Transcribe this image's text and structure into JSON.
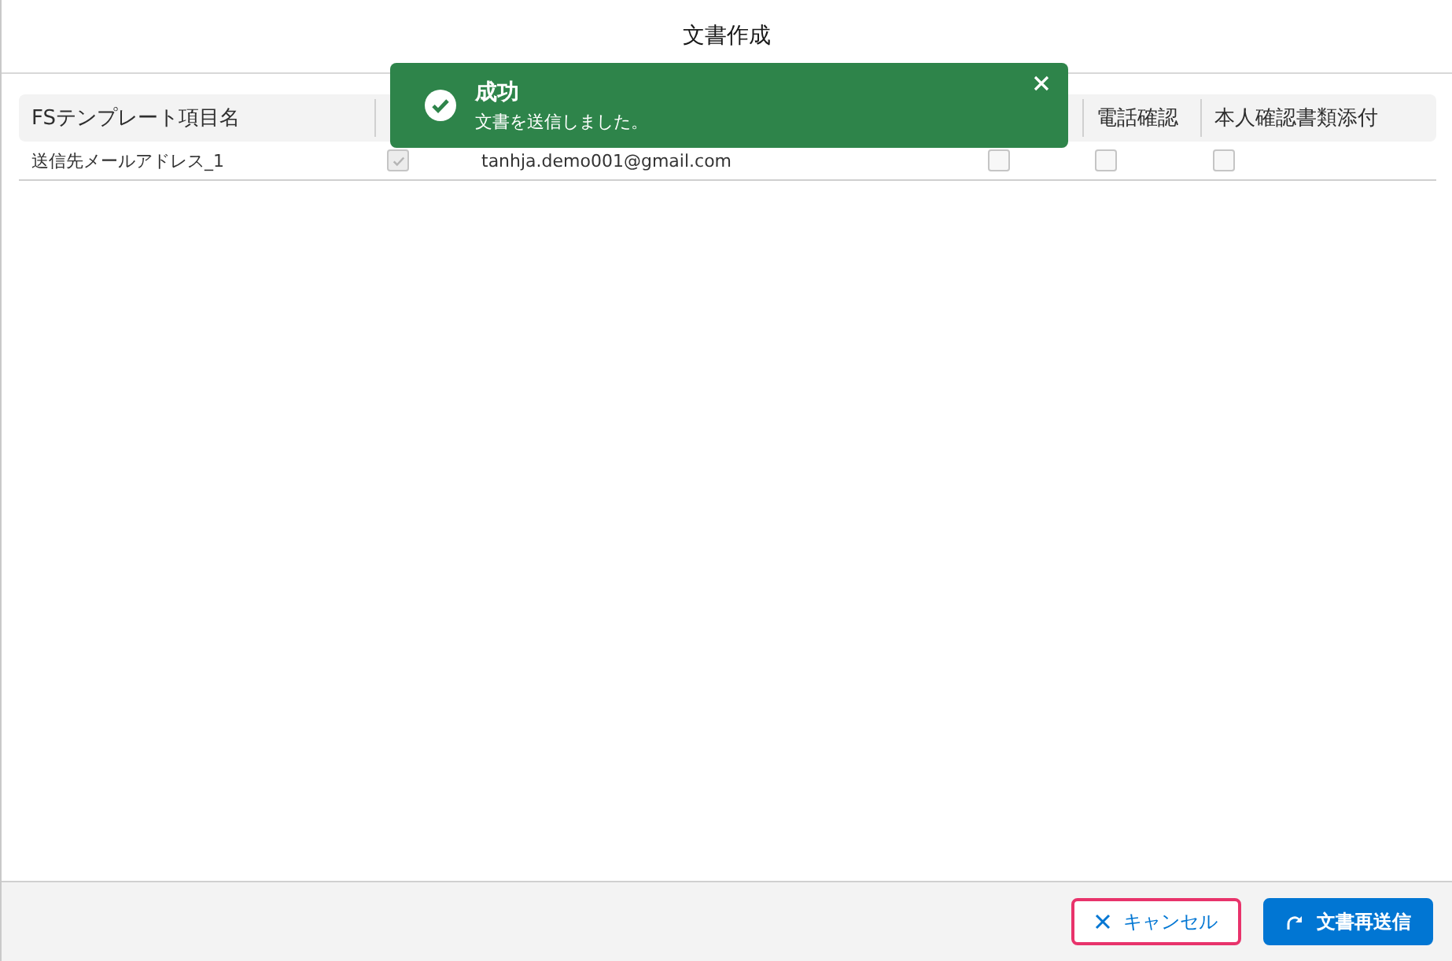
{
  "modal": {
    "title": "文書作成"
  },
  "table": {
    "columns": [
      {
        "label": "FSテンプレート項目名"
      },
      {
        "label": "電話確認"
      },
      {
        "label": "本人確認書類添付"
      }
    ],
    "rows": [
      {
        "cells": [
          {
            "kind": "text",
            "text": "送信先メールアドレス_1"
          },
          {
            "kind": "check",
            "checked": true
          },
          {
            "kind": "text",
            "text": "tanhja.demo001@gmail.com"
          },
          {
            "kind": "check",
            "checked": false
          },
          {
            "kind": "check",
            "checked": false
          },
          {
            "kind": "check",
            "checked": false
          }
        ]
      }
    ]
  },
  "toast": {
    "title": "成功",
    "message": "文書を送信しました。"
  },
  "buttons": [
    {
      "kind": "cancel",
      "label": "キャンセル",
      "highlighted": true
    },
    {
      "kind": "resend",
      "label": "文書再送信",
      "highlighted": false
    }
  ]
}
